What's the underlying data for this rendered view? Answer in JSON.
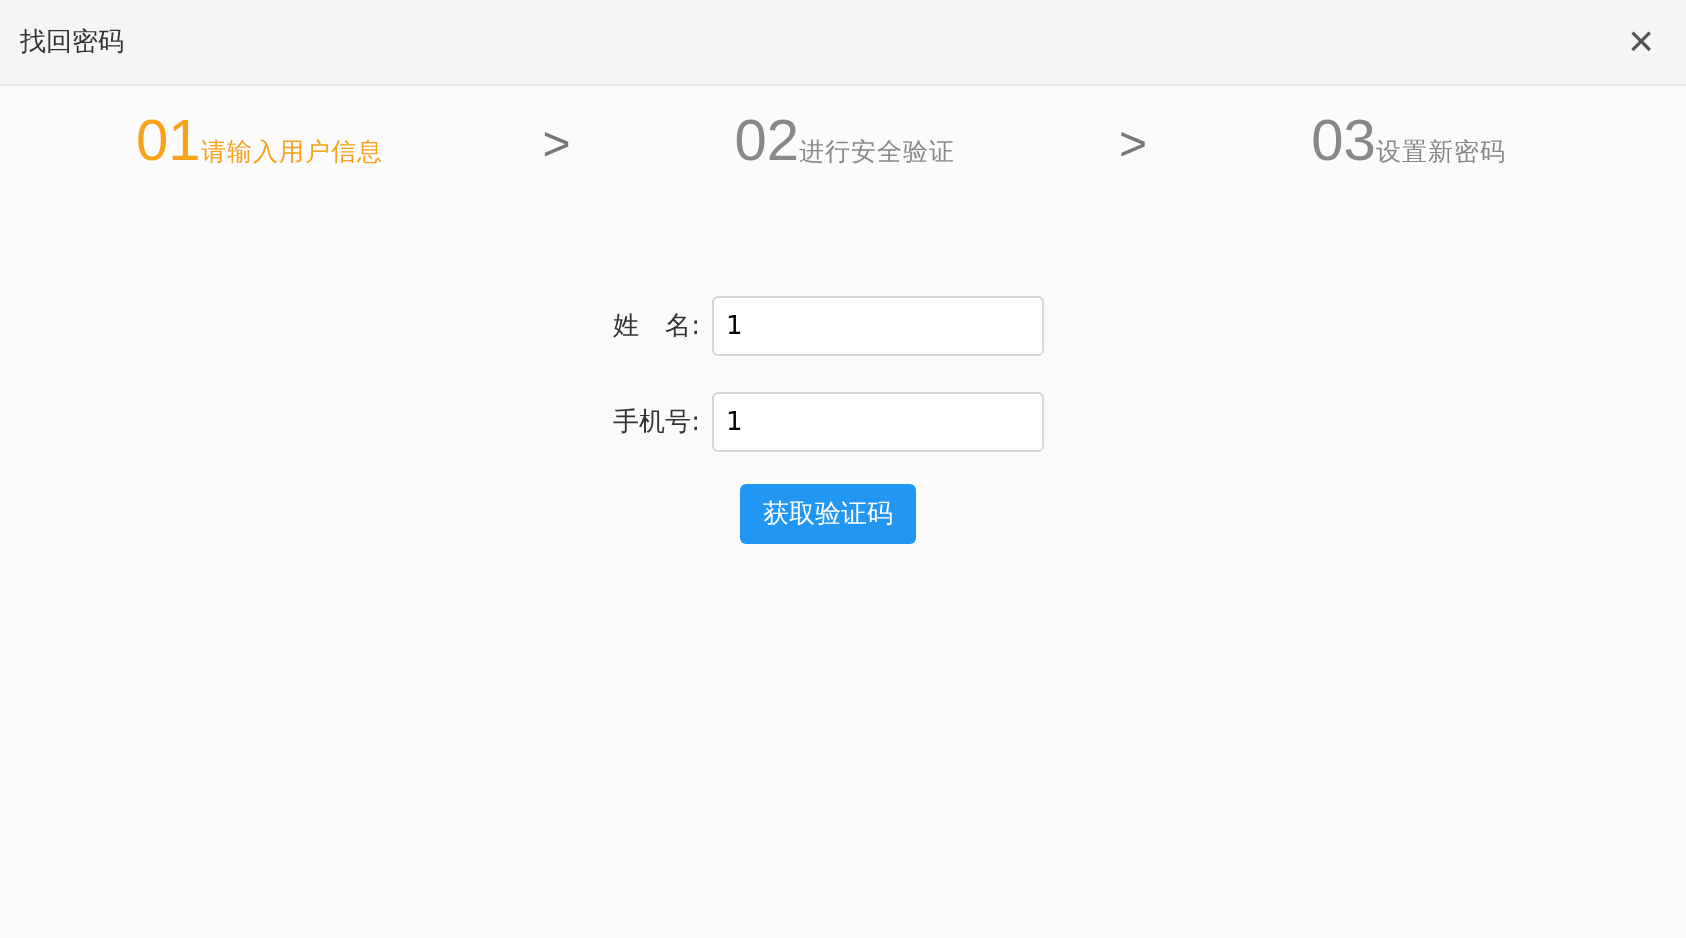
{
  "window": {
    "title": "找回密码",
    "close": "×"
  },
  "steps": [
    {
      "number": "01",
      "label": "请输入用户信息",
      "selected": true
    },
    {
      "number": "02",
      "label": "进行安全验证",
      "selected": false
    },
    {
      "number": "03",
      "label": "设置新密码",
      "selected": false
    }
  ],
  "separators": [
    ">",
    ">"
  ],
  "fields": [
    {
      "label": "姓　名:",
      "value": "1"
    },
    {
      "label": "手机号:",
      "value": "1"
    }
  ],
  "button": "获取验证码"
}
